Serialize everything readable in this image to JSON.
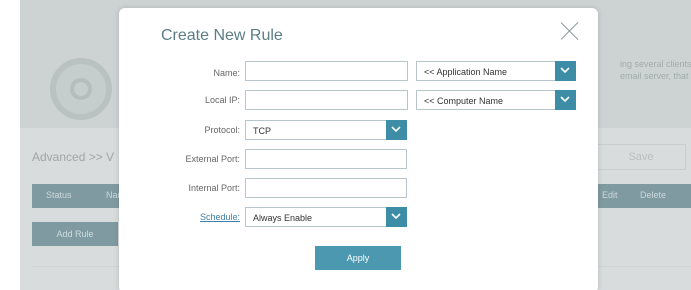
{
  "background": {
    "hero_text_line1": "ing several clients",
    "hero_text_line2": "email server, that",
    "breadcrumb": "Advanced >> V",
    "save_label": "Save",
    "table_headers": [
      "Status",
      "Nar",
      "Edit",
      "Delete"
    ],
    "add_rule_label": "Add Rule"
  },
  "modal": {
    "title": "Create New Rule",
    "fields": {
      "name_label": "Name:",
      "name_value": "",
      "local_ip_label": "Local IP:",
      "local_ip_value": "",
      "protocol_label": "Protocol:",
      "protocol_value": "TCP",
      "external_port_label": "External Port:",
      "external_port_value": "",
      "internal_port_label": "Internal Port:",
      "internal_port_value": "",
      "schedule_label": "Schedule:",
      "schedule_value": "Always Enable"
    },
    "application_select": "<< Application Name",
    "computer_select": "<< Computer Name",
    "apply_label": "Apply"
  },
  "colors": {
    "accent": "#3d8da6",
    "title": "#5c7d86",
    "apply_button": "#4c98b0"
  }
}
